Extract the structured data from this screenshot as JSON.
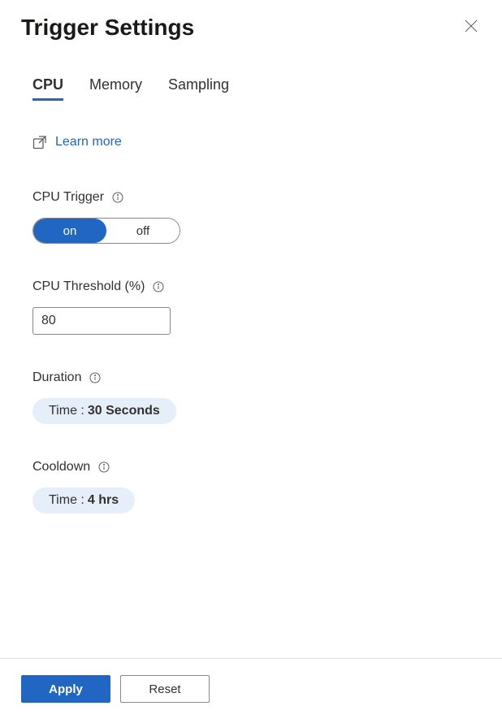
{
  "header": {
    "title": "Trigger Settings"
  },
  "tabs": [
    {
      "label": "CPU",
      "active": true
    },
    {
      "label": "Memory",
      "active": false
    },
    {
      "label": "Sampling",
      "active": false
    }
  ],
  "learnMore": {
    "label": "Learn more"
  },
  "fields": {
    "cpuTrigger": {
      "label": "CPU Trigger",
      "options": {
        "on": "on",
        "off": "off"
      },
      "value": "on"
    },
    "cpuThreshold": {
      "label": "CPU Threshold (%)",
      "value": "80"
    },
    "duration": {
      "label": "Duration",
      "timeLabel": "Time :",
      "timeValue": "30 Seconds"
    },
    "cooldown": {
      "label": "Cooldown",
      "timeLabel": "Time :",
      "timeValue": "4 hrs"
    }
  },
  "footer": {
    "apply": "Apply",
    "reset": "Reset"
  }
}
